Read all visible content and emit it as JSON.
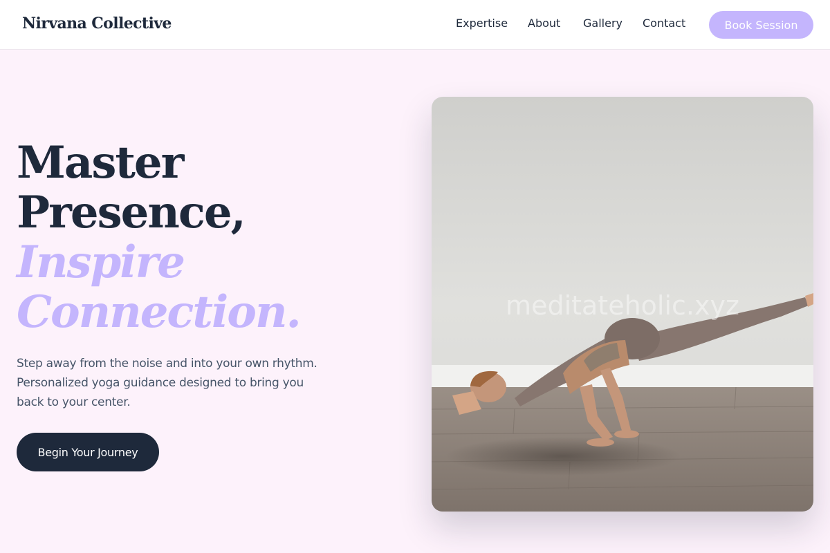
{
  "header": {
    "brand": "Nirvana Collective",
    "nav": {
      "expertise": "Expertise",
      "about": "About",
      "gallery": "Gallery",
      "contact": "Contact"
    },
    "book_button": "Book Session"
  },
  "hero": {
    "title_line_1": "Master",
    "title_line_2": "Presence,",
    "title_accent_line_1": "Inspire",
    "title_accent_line_2": "Connection.",
    "description": "Step away from the noise and into your own rhythm. Personalized yoga guidance designed to bring you back to your center.",
    "cta": "Begin Your Journey"
  },
  "image": {
    "subject": "yoga-practitioner-arm-balance-photo",
    "watermark": "meditateholic.xyz"
  },
  "colors": {
    "background": "#fdf2fb",
    "primary_dark": "#1e293b",
    "accent_lavender": "#c4b5fd",
    "body_text": "#475569",
    "header_bg": "#ffffff"
  }
}
